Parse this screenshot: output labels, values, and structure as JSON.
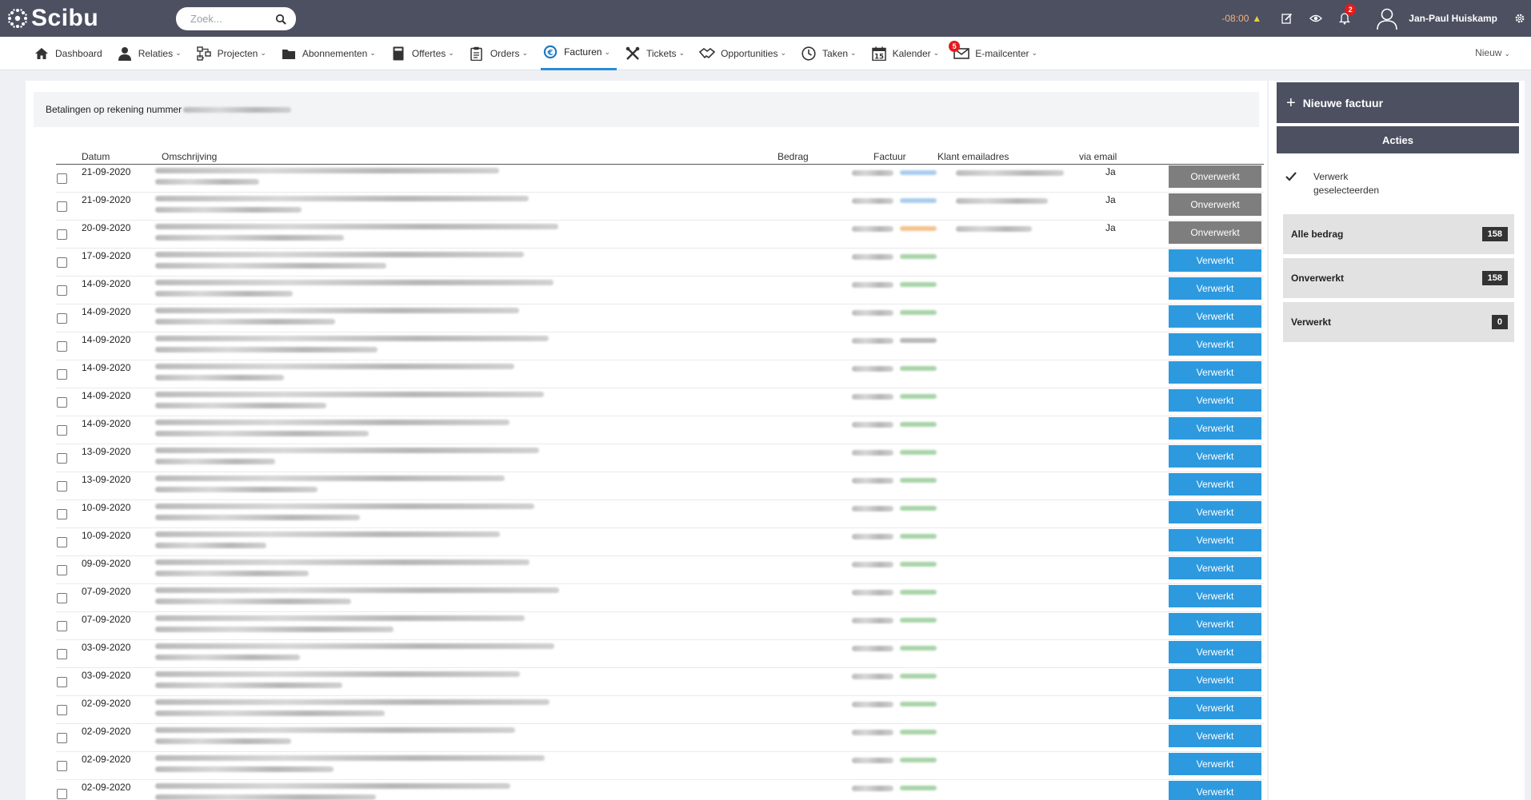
{
  "app": {
    "name": "Scibu"
  },
  "search": {
    "placeholder": "Zoek..."
  },
  "topbar": {
    "timer": "-08:00",
    "notif_count": "2",
    "user_name": "Jan-Paul Huiskamp"
  },
  "nav": {
    "items": [
      {
        "label": "Dashboard",
        "icon": "home-icon",
        "dropdown": false
      },
      {
        "label": "Relaties",
        "icon": "user-icon",
        "dropdown": true
      },
      {
        "label": "Projecten",
        "icon": "project-icon",
        "dropdown": true
      },
      {
        "label": "Abonnementen",
        "icon": "folder-icon",
        "dropdown": true
      },
      {
        "label": "Offertes",
        "icon": "calculator-icon",
        "dropdown": true
      },
      {
        "label": "Orders",
        "icon": "clipboard-icon",
        "dropdown": true
      },
      {
        "label": "Facturen",
        "icon": "euro-icon",
        "dropdown": true,
        "active": true
      },
      {
        "label": "Tickets",
        "icon": "tools-icon",
        "dropdown": true
      },
      {
        "label": "Opportunities",
        "icon": "handshake-icon",
        "dropdown": true
      },
      {
        "label": "Taken",
        "icon": "clock-icon",
        "dropdown": true
      },
      {
        "label": "Kalender",
        "icon": "calendar-icon",
        "dropdown": true,
        "calendar_day": "15"
      },
      {
        "label": "E-mailcenter",
        "icon": "mail-icon",
        "dropdown": true,
        "badge": "5"
      }
    ],
    "new_label": "Nieuw"
  },
  "page": {
    "info_text": "Betalingen op rekening nummer"
  },
  "table": {
    "headers": {
      "date": "Datum",
      "description": "Omschrijving",
      "amount": "Bedrag",
      "invoice": "Factuur",
      "email": "Klant emailadres",
      "via_email": "via email"
    },
    "rows": [
      {
        "date": "21-09-2020",
        "via": "Ja",
        "status": "Onverwerkt",
        "fac": "blue",
        "mail": true
      },
      {
        "date": "21-09-2020",
        "via": "Ja",
        "status": "Onverwerkt",
        "fac": "blue",
        "mail": true
      },
      {
        "date": "20-09-2020",
        "via": "Ja",
        "status": "Onverwerkt",
        "fac": "orange",
        "mail": true
      },
      {
        "date": "17-09-2020",
        "via": "",
        "status": "Verwerkt",
        "fac": "green",
        "mail": false
      },
      {
        "date": "14-09-2020",
        "via": "",
        "status": "Verwerkt",
        "fac": "green",
        "mail": false
      },
      {
        "date": "14-09-2020",
        "via": "",
        "status": "Verwerkt",
        "fac": "green",
        "mail": false
      },
      {
        "date": "14-09-2020",
        "via": "",
        "status": "Verwerkt",
        "fac": "gray",
        "mail": false
      },
      {
        "date": "14-09-2020",
        "via": "",
        "status": "Verwerkt",
        "fac": "green",
        "mail": false
      },
      {
        "date": "14-09-2020",
        "via": "",
        "status": "Verwerkt",
        "fac": "green",
        "mail": false
      },
      {
        "date": "14-09-2020",
        "via": "",
        "status": "Verwerkt",
        "fac": "green",
        "mail": false
      },
      {
        "date": "13-09-2020",
        "via": "",
        "status": "Verwerkt",
        "fac": "green",
        "mail": false
      },
      {
        "date": "13-09-2020",
        "via": "",
        "status": "Verwerkt",
        "fac": "green",
        "mail": false
      },
      {
        "date": "10-09-2020",
        "via": "",
        "status": "Verwerkt",
        "fac": "green",
        "mail": false
      },
      {
        "date": "10-09-2020",
        "via": "",
        "status": "Verwerkt",
        "fac": "green",
        "mail": false
      },
      {
        "date": "09-09-2020",
        "via": "",
        "status": "Verwerkt",
        "fac": "green",
        "mail": false
      },
      {
        "date": "07-09-2020",
        "via": "",
        "status": "Verwerkt",
        "fac": "green",
        "mail": false
      },
      {
        "date": "07-09-2020",
        "via": "",
        "status": "Verwerkt",
        "fac": "green",
        "mail": false
      },
      {
        "date": "03-09-2020",
        "via": "",
        "status": "Verwerkt",
        "fac": "green",
        "mail": false
      },
      {
        "date": "03-09-2020",
        "via": "",
        "status": "Verwerkt",
        "fac": "green",
        "mail": false
      },
      {
        "date": "02-09-2020",
        "via": "",
        "status": "Verwerkt",
        "fac": "green",
        "mail": false
      },
      {
        "date": "02-09-2020",
        "via": "",
        "status": "Verwerkt",
        "fac": "green",
        "mail": false
      },
      {
        "date": "02-09-2020",
        "via": "",
        "status": "Verwerkt",
        "fac": "green",
        "mail": false
      },
      {
        "date": "02-09-2020",
        "via": "",
        "status": "Verwerkt",
        "fac": "green",
        "mail": false
      }
    ]
  },
  "side": {
    "new_invoice": "Nieuwe factuur",
    "actions_title": "Acties",
    "process_selected": "Verwerk geselecteerden",
    "filters": [
      {
        "label": "Alle bedrag",
        "count": "158"
      },
      {
        "label": "Onverwerkt",
        "count": "158"
      },
      {
        "label": "Verwerkt",
        "count": "0"
      }
    ]
  },
  "colors": {
    "topbar": "#4c5061",
    "primary": "#2d9ae0",
    "onverwerkt": "#7e7e7e",
    "active_tab": "#2b8cd6"
  }
}
